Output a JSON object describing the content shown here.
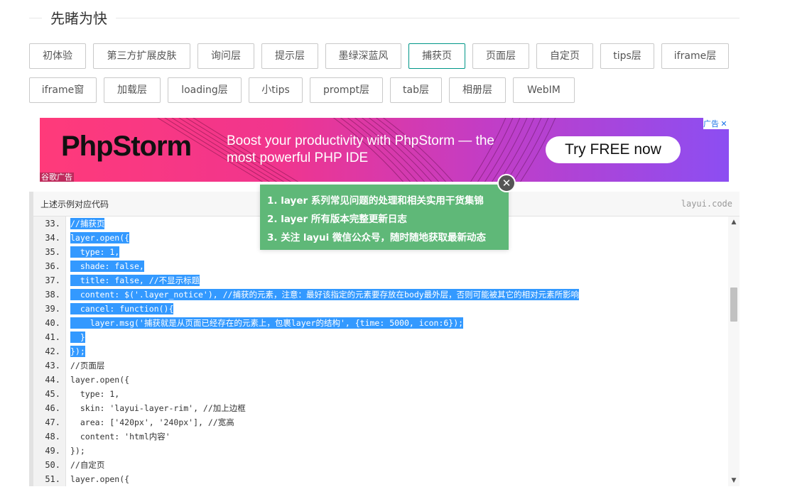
{
  "section": {
    "title": "先睹为快"
  },
  "buttons": [
    "初体验",
    "第三方扩展皮肤",
    "询问层",
    "提示层",
    "墨绿深蓝风",
    "捕获页",
    "页面层",
    "自定页",
    "tips层",
    "iframe层",
    "iframe窗",
    "加载层",
    "loading层",
    "小tips",
    "prompt层",
    "tab层",
    "相册层",
    "WebIM"
  ],
  "ad": {
    "brand": "PhpStorm",
    "tagline": "Boost your productivity with PhpStorm — the most powerful PHP IDE",
    "cta": "Try FREE now",
    "label": "谷歌广告",
    "choice_label": "广告",
    "close_glyph": "✕",
    "colors": {
      "left": "#ff3a7a",
      "right": "#8c4ef2"
    }
  },
  "code": {
    "title": "上述示例对应代码",
    "copyright": "layui.code",
    "lines": [
      {
        "n": "33.",
        "text": "//捕获页",
        "selected": true
      },
      {
        "n": "34.",
        "text": "layer.open({",
        "selected": true
      },
      {
        "n": "35.",
        "text": "  type: 1,",
        "selected": true
      },
      {
        "n": "36.",
        "text": "  shade: false,",
        "selected": true
      },
      {
        "n": "37.",
        "text": "  title: false, //不显示标题",
        "selected": true
      },
      {
        "n": "38.",
        "text": "  content: $('.layer_notice'), //捕获的元素，注意：最好该指定的元素要存放在body最外层，否则可能被其它的相对元素所影响",
        "selected": true
      },
      {
        "n": "39.",
        "text": "  cancel: function(){",
        "selected": true
      },
      {
        "n": "40.",
        "text": "    layer.msg('捕获就是从页面已经存在的元素上，包裹layer的结构', {time: 5000, icon:6});",
        "selected": true
      },
      {
        "n": "41.",
        "text": "  }",
        "selected": true
      },
      {
        "n": "42.",
        "text": "});",
        "selected": true
      },
      {
        "n": "43.",
        "text": "//页面层",
        "selected": false
      },
      {
        "n": "44.",
        "text": "layer.open({",
        "selected": false
      },
      {
        "n": "45.",
        "text": "  type: 1,",
        "selected": false
      },
      {
        "n": "46.",
        "text": "  skin: 'layui-layer-rim', //加上边框",
        "selected": false
      },
      {
        "n": "47.",
        "text": "  area: ['420px', '240px'], //宽高",
        "selected": false
      },
      {
        "n": "48.",
        "text": "  content: 'html内容'",
        "selected": false
      },
      {
        "n": "49.",
        "text": "});",
        "selected": false
      },
      {
        "n": "50.",
        "text": "//自定页",
        "selected": false
      },
      {
        "n": "51.",
        "text": "layer.open({",
        "selected": false
      }
    ]
  },
  "tip": {
    "items": [
      "1. layer 系列常见问题的处理和相关实用干货集锦",
      "2. layer 所有版本完整更新日志",
      "3. 关注 layui 微信公众号，随时随地获取最新动态"
    ],
    "close_glyph": "✕",
    "color": "#5fb878"
  }
}
